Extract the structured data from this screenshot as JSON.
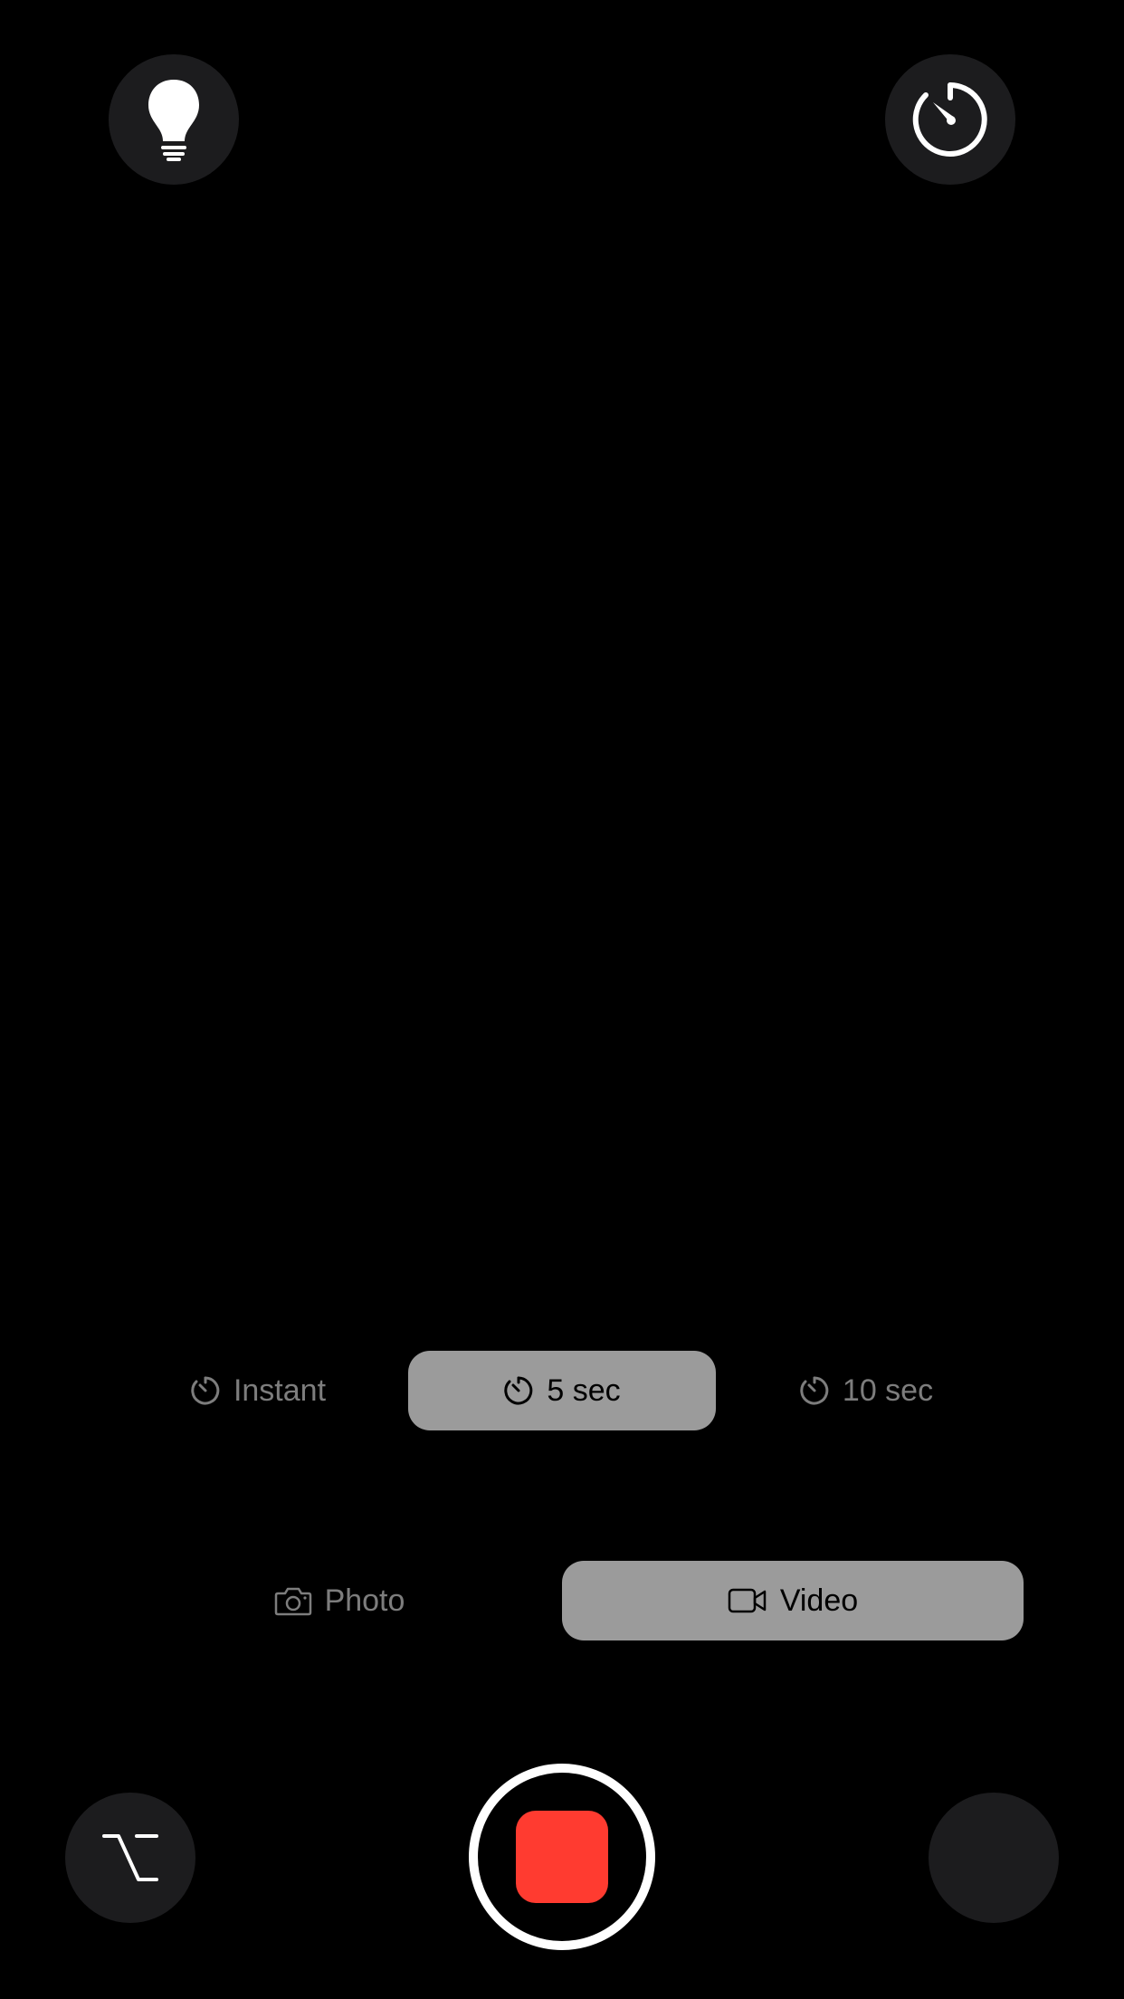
{
  "top_controls": {
    "flash_icon": "lightbulb-icon",
    "timer_icon": "timer-icon"
  },
  "timer_options": [
    {
      "label": "Instant",
      "icon": "timer-icon",
      "selected": false
    },
    {
      "label": "5 sec",
      "icon": "timer-icon",
      "selected": true
    },
    {
      "label": "10 sec",
      "icon": "timer-icon",
      "selected": false
    }
  ],
  "capture_modes": [
    {
      "label": "Photo",
      "icon": "camera-icon",
      "selected": false
    },
    {
      "label": "Video",
      "icon": "video-camera-icon",
      "selected": true
    }
  ],
  "bottom_controls": {
    "option_icon": "option-key-icon",
    "shutter_state": "recording-stop",
    "gallery_icon": "thumbnail"
  },
  "colors": {
    "background": "#000000",
    "button_background": "#1c1c1e",
    "selected_segment": "#9b9b9b",
    "unselected_text": "#7d7d7d",
    "record_red": "#ff3b30"
  }
}
